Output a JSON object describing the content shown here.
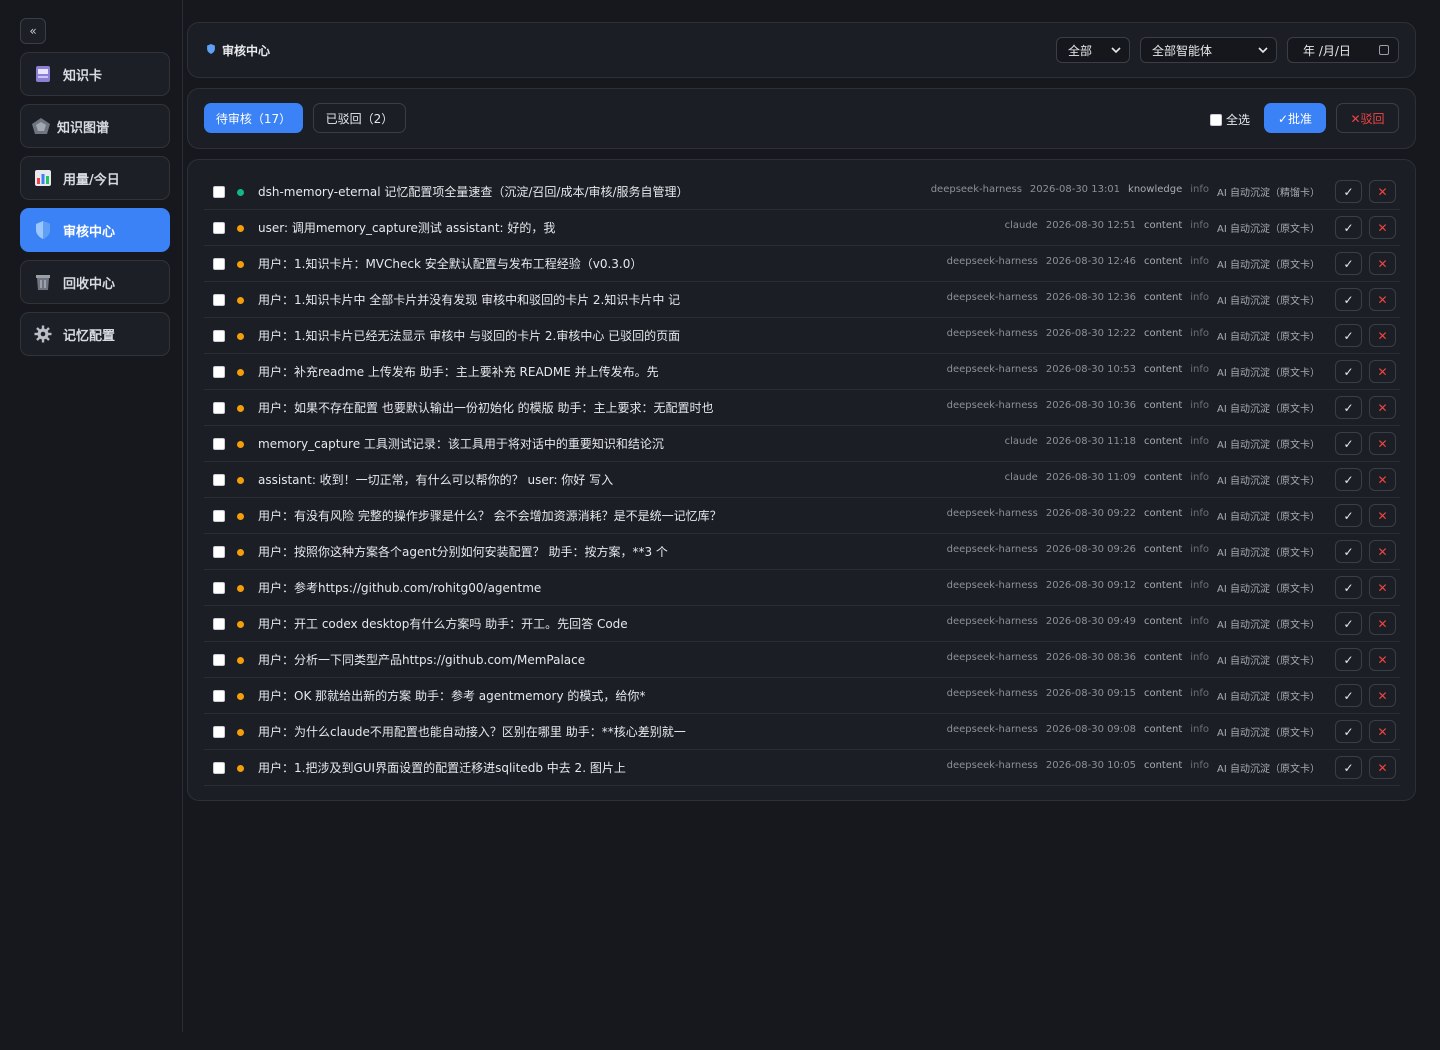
{
  "sidebar": {
    "collapse_label": "«",
    "items": [
      {
        "label": "知识卡",
        "icon": "card-icon"
      },
      {
        "label": "知识图谱",
        "icon": "graph-icon"
      },
      {
        "label": "用量/今日",
        "icon": "chart-icon"
      },
      {
        "label": "审核中心",
        "icon": "shield-icon",
        "active": true
      },
      {
        "label": "回收中心",
        "icon": "trash-icon"
      },
      {
        "label": "记忆配置",
        "icon": "gear-icon"
      }
    ]
  },
  "header": {
    "title": "审核中心",
    "filter_all": "全部",
    "filter_agent": "全部智能体",
    "date_placeholder": "年 /月/日"
  },
  "tabs": {
    "pending": "待审核（17）",
    "rejected": "已驳回（2）"
  },
  "actions": {
    "select_all": "全选",
    "approve": "✓批准",
    "reject": "✕驳回"
  },
  "colors": {
    "accent": "#3b82f6",
    "status_green": "#10b981",
    "status_orange": "#f59e0b",
    "danger": "#ef4444"
  },
  "rows": [
    {
      "title": "dsh-memory-eternal 记忆配置项全量速查（沉淀/召回/成本/审核/服务自管理）",
      "agent": "deepseek-harness",
      "time": "2026-08-30 13:01",
      "type": "knowledge",
      "level": "info",
      "source": "AI 自动沉淀（精馏卡）",
      "status": "green"
    },
    {
      "title": "user: 调用memory_capture测试 assistant: 好的，我",
      "agent": "claude",
      "time": "2026-08-30 12:51",
      "type": "content",
      "level": "info",
      "source": "AI 自动沉淀（原文卡）",
      "status": "orange"
    },
    {
      "title": "用户：1.知识卡片：MVCheck 安全默认配置与发布工程经验（v0.3.0）",
      "agent": "deepseek-harness",
      "time": "2026-08-30 12:46",
      "type": "content",
      "level": "info",
      "source": "AI 自动沉淀（原文卡）",
      "status": "orange"
    },
    {
      "title": "用户：1.知识卡片中 全部卡片并没有发现 审核中和驳回的卡片 2.知识卡片中 记",
      "agent": "deepseek-harness",
      "time": "2026-08-30 12:36",
      "type": "content",
      "level": "info",
      "source": "AI 自动沉淀（原文卡）",
      "status": "orange"
    },
    {
      "title": "用户：1.知识卡片已经无法显示 审核中 与驳回的卡片 2.审核中心 已驳回的页面",
      "agent": "deepseek-harness",
      "time": "2026-08-30 12:22",
      "type": "content",
      "level": "info",
      "source": "AI 自动沉淀（原文卡）",
      "status": "orange"
    },
    {
      "title": "用户：补充readme 上传发布 助手：主上要补充 README 并上传发布。先",
      "agent": "deepseek-harness",
      "time": "2026-08-30 10:53",
      "type": "content",
      "level": "info",
      "source": "AI 自动沉淀（原文卡）",
      "status": "orange"
    },
    {
      "title": "用户：如果不存在配置 也要默认输出一份初始化 的模版 助手：主上要求：无配置时也",
      "agent": "deepseek-harness",
      "time": "2026-08-30 10:36",
      "type": "content",
      "level": "info",
      "source": "AI 自动沉淀（原文卡）",
      "status": "orange"
    },
    {
      "title": "memory_capture 工具测试记录：该工具用于将对话中的重要知识和结论沉",
      "agent": "claude",
      "time": "2026-08-30 11:18",
      "type": "content",
      "level": "info",
      "source": "AI 自动沉淀（原文卡）",
      "status": "orange"
    },
    {
      "title": "assistant: 收到！一切正常，有什么可以帮你的？ user: 你好 写入",
      "agent": "claude",
      "time": "2026-08-30 11:09",
      "type": "content",
      "level": "info",
      "source": "AI 自动沉淀（原文卡）",
      "status": "orange"
    },
    {
      "title": "用户：有没有风险 完整的操作步骤是什么？ 会不会增加资源消耗？是不是统一记忆库？",
      "agent": "deepseek-harness",
      "time": "2026-08-30 09:22",
      "type": "content",
      "level": "info",
      "source": "AI 自动沉淀（原文卡）",
      "status": "orange"
    },
    {
      "title": "用户：按照你这种方案各个agent分别如何安装配置？ 助手：按方案，**3 个",
      "agent": "deepseek-harness",
      "time": "2026-08-30 09:26",
      "type": "content",
      "level": "info",
      "source": "AI 自动沉淀（原文卡）",
      "status": "orange"
    },
    {
      "title": "用户：参考https://github.com/rohitg00/agentme",
      "agent": "deepseek-harness",
      "time": "2026-08-30 09:12",
      "type": "content",
      "level": "info",
      "source": "AI 自动沉淀（原文卡）",
      "status": "orange"
    },
    {
      "title": "用户：开工 codex desktop有什么方案吗 助手：开工。先回答 Code",
      "agent": "deepseek-harness",
      "time": "2026-08-30 09:49",
      "type": "content",
      "level": "info",
      "source": "AI 自动沉淀（原文卡）",
      "status": "orange"
    },
    {
      "title": "用户：分析一下同类型产品https://github.com/MemPalace",
      "agent": "deepseek-harness",
      "time": "2026-08-30 08:36",
      "type": "content",
      "level": "info",
      "source": "AI 自动沉淀（原文卡）",
      "status": "orange"
    },
    {
      "title": "用户：OK 那就给出新的方案 助手：参考 agentmemory 的模式，给你*",
      "agent": "deepseek-harness",
      "time": "2026-08-30 09:15",
      "type": "content",
      "level": "info",
      "source": "AI 自动沉淀（原文卡）",
      "status": "orange"
    },
    {
      "title": "用户：为什么claude不用配置也能自动接入？区别在哪里 助手：**核心差别就一",
      "agent": "deepseek-harness",
      "time": "2026-08-30 09:08",
      "type": "content",
      "level": "info",
      "source": "AI 自动沉淀（原文卡）",
      "status": "orange"
    },
    {
      "title": "用户：1.把涉及到GUI界面设置的配置迁移进sqlitedb 中去 2. 图片上",
      "agent": "deepseek-harness",
      "time": "2026-08-30 10:05",
      "type": "content",
      "level": "info",
      "source": "AI 自动沉淀（原文卡）",
      "status": "orange"
    }
  ]
}
